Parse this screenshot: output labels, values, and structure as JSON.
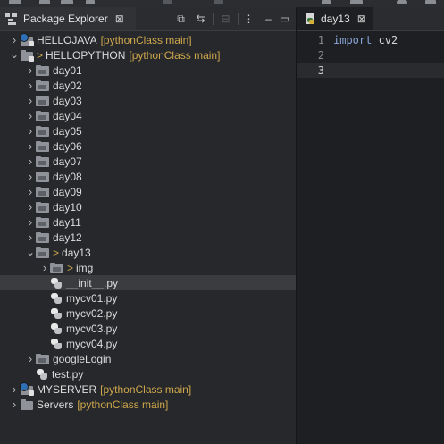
{
  "colors": {
    "background": "#1e1f22",
    "panel": "#26282b",
    "selection": "#3a3c40",
    "git_decoration": "#cfa84c",
    "keyword": "#8aa6d8"
  },
  "package_explorer": {
    "tab_label": "Package Explorer",
    "close_glyph": "⊠",
    "toolbar_glyphs": {
      "collapse_all": "⧉",
      "link_editor": "⇆",
      "filter": "⊟",
      "menu": "⋮",
      "minimize": "–",
      "maximize": "▭"
    },
    "tree": [
      {
        "kind": "project",
        "name": "HELLOJAVA",
        "repo": "[pythonClass main]",
        "level": 0,
        "expanded": false,
        "icon": "java-project-icon"
      },
      {
        "kind": "project",
        "prefix": ">",
        "name": "HELLOPYTHON",
        "repo": "[pythonClass main]",
        "level": 0,
        "expanded": true,
        "icon": "python-project-icon"
      },
      {
        "kind": "folder",
        "name": "day01",
        "level": 1,
        "expanded": false
      },
      {
        "kind": "folder",
        "name": "day02",
        "level": 1,
        "expanded": false
      },
      {
        "kind": "folder",
        "name": "day03",
        "level": 1,
        "expanded": false
      },
      {
        "kind": "folder",
        "name": "day04",
        "level": 1,
        "expanded": false
      },
      {
        "kind": "folder",
        "name": "day05",
        "level": 1,
        "expanded": false
      },
      {
        "kind": "folder",
        "name": "day06",
        "level": 1,
        "expanded": false
      },
      {
        "kind": "folder",
        "name": "day07",
        "level": 1,
        "expanded": false
      },
      {
        "kind": "folder",
        "name": "day08",
        "level": 1,
        "expanded": false
      },
      {
        "kind": "folder",
        "name": "day09",
        "level": 1,
        "expanded": false
      },
      {
        "kind": "folder",
        "name": "day10",
        "level": 1,
        "expanded": false
      },
      {
        "kind": "folder",
        "name": "day11",
        "level": 1,
        "expanded": false
      },
      {
        "kind": "folder",
        "name": "day12",
        "level": 1,
        "expanded": false
      },
      {
        "kind": "folder",
        "prefix": ">",
        "name": "day13",
        "level": 1,
        "expanded": true
      },
      {
        "kind": "folder",
        "prefix": ">",
        "name": "img",
        "level": 2,
        "expanded": false
      },
      {
        "kind": "file",
        "name": "__init__.py",
        "level": 2,
        "selected": true
      },
      {
        "kind": "file",
        "name": "mycv01.py",
        "level": 2
      },
      {
        "kind": "file",
        "name": "mycv02.py",
        "level": 2
      },
      {
        "kind": "file",
        "name": "mycv03.py",
        "level": 2
      },
      {
        "kind": "file",
        "name": "mycv04.py",
        "level": 2
      },
      {
        "kind": "folder",
        "name": "googleLogin",
        "level": 1,
        "expanded": false
      },
      {
        "kind": "file",
        "name": "test.py",
        "level": 1
      },
      {
        "kind": "project",
        "name": "MYSERVER",
        "repo": "[pythonClass main]",
        "level": 0,
        "expanded": false,
        "icon": "java-project-icon"
      },
      {
        "kind": "project",
        "name": "Servers",
        "repo": "[pythonClass main]",
        "level": 0,
        "expanded": false,
        "icon": "servers-project-icon"
      }
    ]
  },
  "editor": {
    "tab_label": "day13",
    "close_glyph": "⊠",
    "lines": [
      {
        "number": "1",
        "keyword": "import",
        "text": " cv2"
      },
      {
        "number": "2",
        "keyword": "",
        "text": ""
      },
      {
        "number": "3",
        "keyword": "",
        "text": "",
        "current": true
      }
    ]
  }
}
